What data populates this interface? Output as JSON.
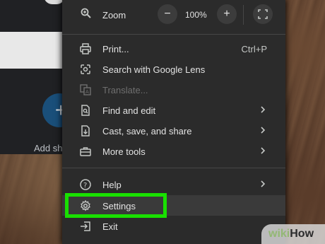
{
  "background": {
    "new_tab_label": "Add sh"
  },
  "zoom": {
    "label": "Zoom",
    "minus": "−",
    "plus": "+",
    "value": "100%"
  },
  "items": [
    {
      "label": "Print...",
      "shortcut": "Ctrl+P"
    },
    {
      "label": "Search with Google Lens"
    },
    {
      "label": "Translate..."
    },
    {
      "label": "Find and edit"
    },
    {
      "label": "Cast, save, and share"
    },
    {
      "label": "More tools"
    },
    {
      "label": "Help"
    },
    {
      "label": "Settings"
    },
    {
      "label": "Exit"
    }
  ],
  "colors": {
    "highlight": "#19e000",
    "menu_bg": "#2b2b2b"
  },
  "watermark": {
    "wiki": "wiki",
    "how": "How"
  }
}
